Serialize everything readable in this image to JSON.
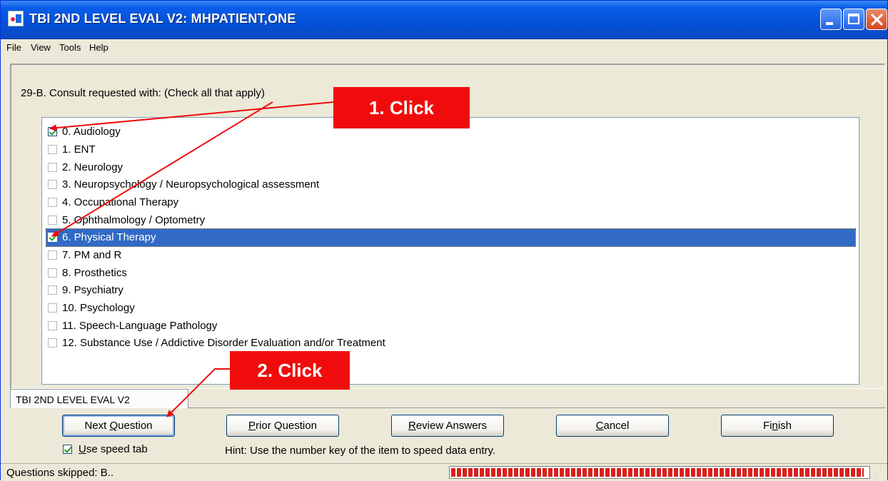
{
  "window": {
    "title": "TBI 2ND LEVEL EVAL V2: MHPATIENT,ONE"
  },
  "menu": [
    "File",
    "View",
    "Tools",
    "Help"
  ],
  "question": "29-B. Consult requested with: (Check all that apply)",
  "options": [
    {
      "label": "0. Audiology",
      "checked": true
    },
    {
      "label": "1. ENT",
      "checked": false
    },
    {
      "label": "2. Neurology",
      "checked": false
    },
    {
      "label": "3. Neuropsychology / Neuropsychological assessment",
      "checked": false
    },
    {
      "label": "4. Occupational Therapy",
      "checked": false
    },
    {
      "label": "5. Ophthalmology / Optometry",
      "checked": false
    },
    {
      "label": "6. Physical Therapy",
      "checked": true,
      "selected": true
    },
    {
      "label": "7. PM and R",
      "checked": false
    },
    {
      "label": "8. Prosthetics",
      "checked": false
    },
    {
      "label": "9. Psychiatry",
      "checked": false
    },
    {
      "label": "10. Psychology",
      "checked": false
    },
    {
      "label": "11. Speech-Language Pathology",
      "checked": false
    },
    {
      "label": "12. Substance Use / Addictive Disorder Evaluation and/or Treatment",
      "checked": false
    }
  ],
  "tab": {
    "label": "TBI 2ND LEVEL EVAL V2"
  },
  "buttons": {
    "next": {
      "pre": "Next ",
      "key": "Q",
      "post": "uestion"
    },
    "prior": {
      "pre": "",
      "key": "P",
      "post": "rior Question"
    },
    "review": {
      "pre": "",
      "key": "R",
      "post": "eview Answers"
    },
    "cancel": {
      "pre": "",
      "key": "C",
      "post": "ancel"
    },
    "finish": {
      "pre": "Fi",
      "key": "n",
      "post": "ish"
    }
  },
  "speed_tab": {
    "pre": "",
    "key": "U",
    "post": "se speed tab",
    "checked": true
  },
  "hint": "Hint: Use the number key of the item to speed data entry.",
  "status": {
    "text": "Questions skipped: B..",
    "progress": 0.99
  },
  "annotations": {
    "callout1": "1. Click",
    "callout2": "2. Click",
    "color": "#F00C0C"
  }
}
